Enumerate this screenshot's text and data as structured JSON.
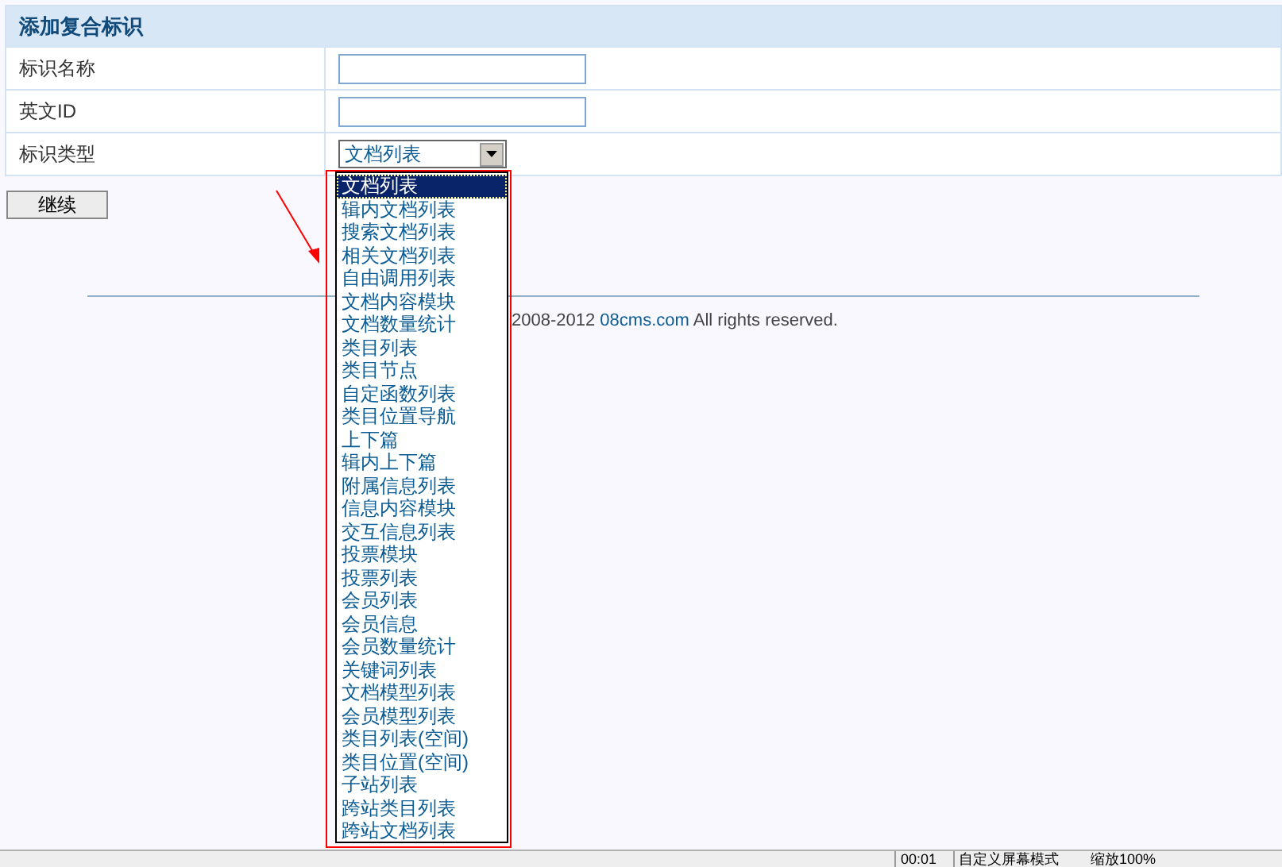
{
  "form": {
    "title": "添加复合标识",
    "rows": [
      {
        "label": "标识名称",
        "kind": "text",
        "value": ""
      },
      {
        "label": "英文ID",
        "kind": "text",
        "value": ""
      },
      {
        "label": "标识类型",
        "kind": "select",
        "value": "文档列表"
      }
    ],
    "submit": "继续"
  },
  "dropdown": {
    "options": [
      {
        "label": "文档列表",
        "selected": true
      },
      {
        "label": "辑内文档列表",
        "selected": false
      },
      {
        "label": "搜索文档列表",
        "selected": false
      },
      {
        "label": "相关文档列表",
        "selected": false
      },
      {
        "label": "自由调用列表",
        "selected": false
      },
      {
        "label": "文档内容模块",
        "selected": false
      },
      {
        "label": "文档数量统计",
        "selected": false
      },
      {
        "label": "类目列表",
        "selected": false
      },
      {
        "label": "类目节点",
        "selected": false
      },
      {
        "label": "自定函数列表",
        "selected": false
      },
      {
        "label": "类目位置导航",
        "selected": false
      },
      {
        "label": "上下篇",
        "selected": false
      },
      {
        "label": "辑内上下篇",
        "selected": false
      },
      {
        "label": "附属信息列表",
        "selected": false
      },
      {
        "label": "信息内容模块",
        "selected": false
      },
      {
        "label": "交互信息列表",
        "selected": false
      },
      {
        "label": "投票模块",
        "selected": false
      },
      {
        "label": "投票列表",
        "selected": false
      },
      {
        "label": "会员列表",
        "selected": false
      },
      {
        "label": "会员信息",
        "selected": false
      },
      {
        "label": "会员数量统计",
        "selected": false
      },
      {
        "label": "关键词列表",
        "selected": false
      },
      {
        "label": "文档模型列表",
        "selected": false
      },
      {
        "label": "会员模型列表",
        "selected": false
      },
      {
        "label": "类目列表(空间)",
        "selected": false
      },
      {
        "label": "类目位置(空间)",
        "selected": false
      },
      {
        "label": "子站列表",
        "selected": false
      },
      {
        "label": "跨站类目列表",
        "selected": false
      },
      {
        "label": "跨站文档列表",
        "selected": false
      }
    ]
  },
  "footer": {
    "years": "2008-2012",
    "link": "08cms.com",
    "rest": "All rights reserved."
  },
  "status_bar": {
    "time": "00:01",
    "mode": "自定义屏幕模式",
    "zoom": "缩放100%"
  }
}
